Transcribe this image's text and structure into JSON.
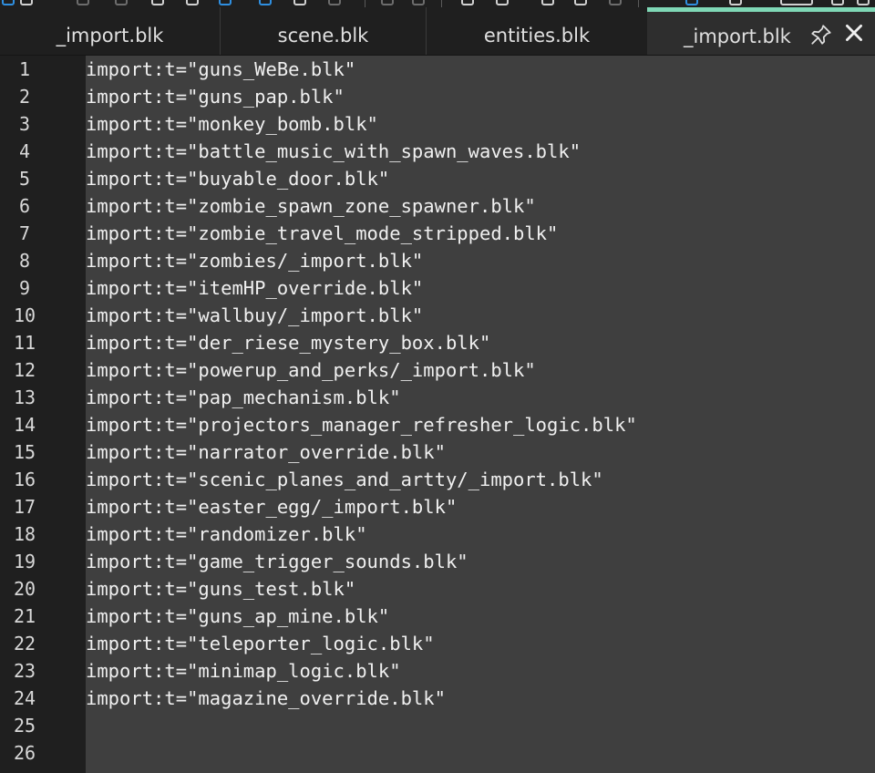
{
  "tabs": [
    {
      "label": "_import.blk"
    },
    {
      "label": "scene.blk"
    },
    {
      "label": "entities.blk"
    },
    {
      "label": "_import.blk"
    }
  ],
  "editor": {
    "line_numbers": [
      "1",
      "2",
      "3",
      "4",
      "5",
      "6",
      "7",
      "8",
      "9",
      "10",
      "11",
      "12",
      "13",
      "14",
      "15",
      "16",
      "17",
      "18",
      "19",
      "20",
      "21",
      "22",
      "23",
      "24",
      "25",
      "26"
    ],
    "lines": [
      "import:t=\"guns_WeBe.blk\"",
      "import:t=\"guns_pap.blk\"",
      "import:t=\"monkey_bomb.blk\"",
      "import:t=\"battle_music_with_spawn_waves.blk\"",
      "import:t=\"buyable_door.blk\"",
      "import:t=\"zombie_spawn_zone_spawner.blk\"",
      "import:t=\"zombie_travel_mode_stripped.blk\"",
      "import:t=\"zombies/_import.blk\"",
      "import:t=\"itemHP_override.blk\"",
      "import:t=\"wallbuy/_import.blk\"",
      "import:t=\"der_riese_mystery_box.blk\"",
      "import:t=\"powerup_and_perks/_import.blk\"",
      "import:t=\"pap_mechanism.blk\"",
      "import:t=\"projectors_manager_refresher_logic.blk\"",
      "import:t=\"narrator_override.blk\"",
      "import:t=\"scenic_planes_and_artty/_import.blk\"",
      "import:t=\"easter_egg/_import.blk\"",
      "import:t=\"randomizer.blk\"",
      "import:t=\"game_trigger_sounds.blk\"",
      "import:t=\"guns_test.blk\"",
      "import:t=\"guns_ap_mine.blk\"",
      "import:t=\"teleporter_logic.blk\"",
      "import:t=\"minimap_logic.blk\"",
      "import:t=\"magazine_override.blk\"",
      "",
      ""
    ]
  },
  "colors": {
    "active_tab_accent": "#7fd8b6",
    "editor_bg": "#3f3f3f",
    "gutter_bg": "#1f1f1f"
  }
}
